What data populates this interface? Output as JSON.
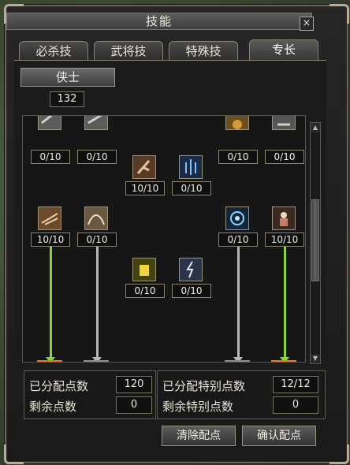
{
  "window": {
    "title": "技能",
    "close_glyph": "×"
  },
  "tabs": [
    {
      "label": "必杀技",
      "active": false
    },
    {
      "label": "武将技",
      "active": false
    },
    {
      "label": "特殊技",
      "active": false
    },
    {
      "label": "专长",
      "active": true
    }
  ],
  "class_button": "侠士",
  "level_value": "132",
  "skills": [
    {
      "id": "top1",
      "count": "0/10"
    },
    {
      "id": "top2",
      "count": "0/10"
    },
    {
      "id": "top3",
      "count": "0/10"
    },
    {
      "id": "top4",
      "count": "0/10"
    },
    {
      "id": "mid1",
      "count": "10/10"
    },
    {
      "id": "mid2",
      "count": "0/10"
    },
    {
      "id": "row3_1",
      "count": "10/10"
    },
    {
      "id": "row3_2",
      "count": "0/10"
    },
    {
      "id": "row3_3",
      "count": "0/10"
    },
    {
      "id": "row3_4",
      "count": "10/10"
    },
    {
      "id": "row4_1",
      "count": "0/10"
    },
    {
      "id": "row4_2",
      "count": "0/10"
    }
  ],
  "stats": {
    "allocated_label": "已分配点数",
    "allocated_value": "120",
    "remaining_label": "剩余点数",
    "remaining_value": "0",
    "special_allocated_label": "已分配特别点数",
    "special_allocated_value": "12/12",
    "special_remaining_label": "剩余特别点数",
    "special_remaining_value": "0"
  },
  "buttons": {
    "clear": "清除配点",
    "confirm": "确认配点"
  },
  "colors": {
    "active_link": "#8fd13c",
    "inactive_link": "#b7b7b7"
  }
}
